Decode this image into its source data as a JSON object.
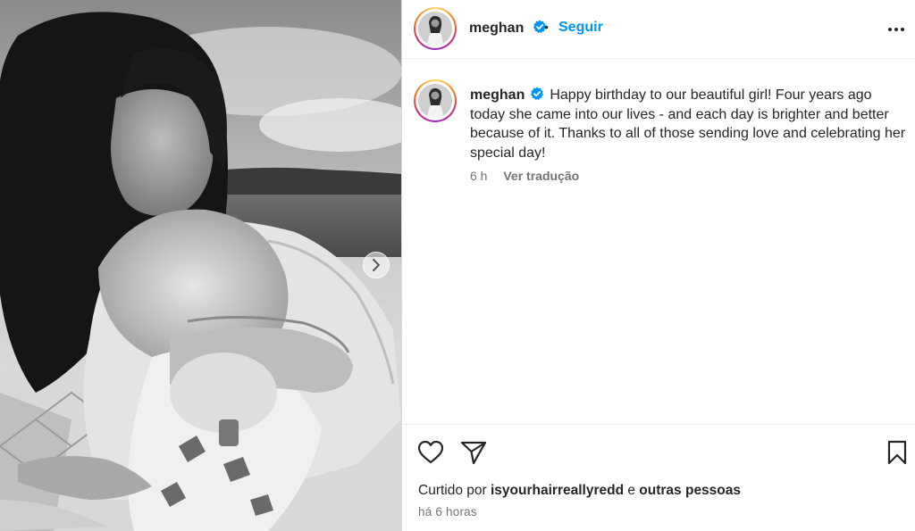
{
  "post": {
    "username": "meghan",
    "separator": "•",
    "follow_label": "Seguir",
    "caption_text": "Happy birthday to our beautiful girl! Four years ago today she came into our lives - and each day is brighter and better because of it. Thanks to all of those sending love and celebrating her special day!",
    "age_short": "6 h",
    "translate_label": "Ver tradução"
  },
  "likes": {
    "prefix": "Curtido por",
    "liker": "isyourhairreallyredd",
    "connector": "e",
    "others": "outras pessoas"
  },
  "timestamp": "há 6 horas",
  "icons": {
    "verified": "verified-badge-icon",
    "more": "more-options-icon",
    "like": "heart-icon",
    "share": "paper-plane-icon",
    "save": "bookmark-icon",
    "carousel": "chevron-right-icon"
  },
  "colors": {
    "link": "#0095f6",
    "text": "#262626",
    "muted": "#737373",
    "verified": "#0095f6"
  }
}
